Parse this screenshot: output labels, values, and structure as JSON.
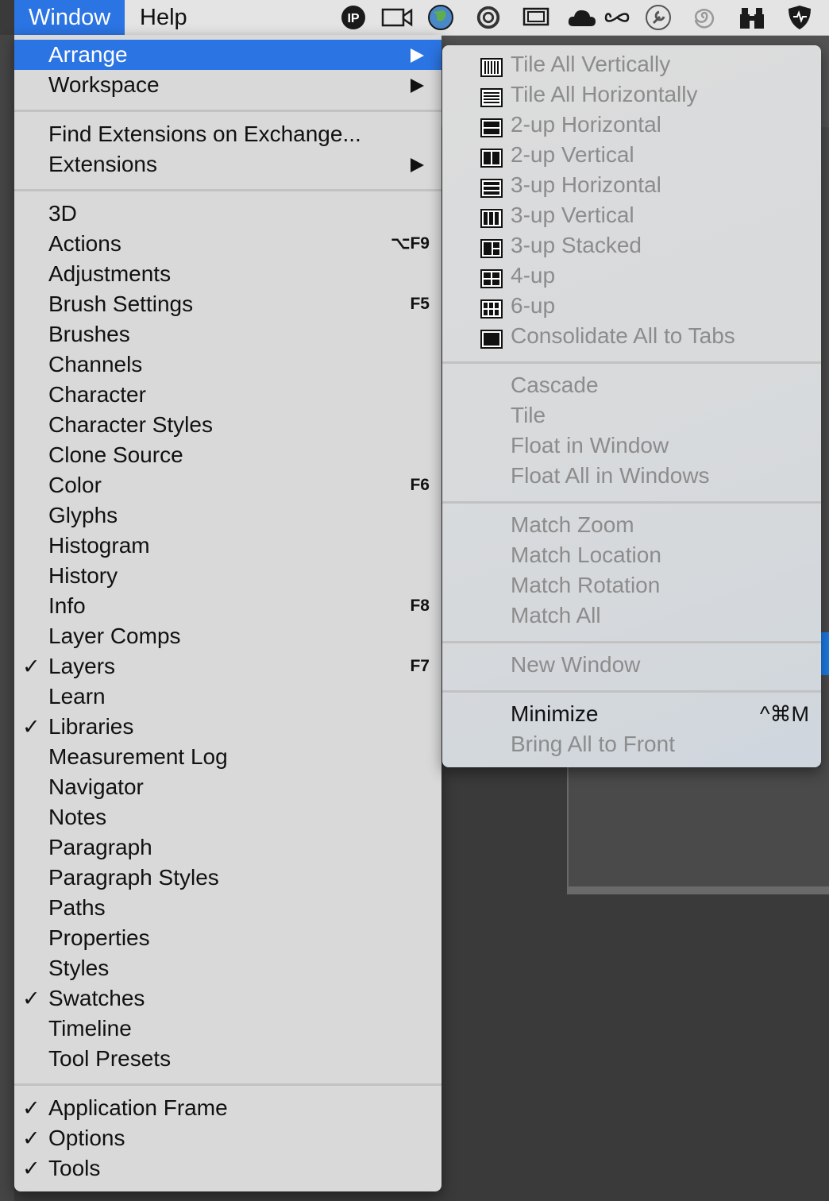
{
  "menubar": {
    "window_label": "Window",
    "help_label": "Help",
    "status_icons": [
      "ip-icon",
      "video-camera-icon",
      "globe-icon",
      "creative-cloud-icon",
      "display-icon",
      "cloud-icon",
      "infinity-icon",
      "wrench-icon",
      "spiral-icon",
      "binoculars-icon",
      "shield-icon"
    ]
  },
  "menu": {
    "arrange": "Arrange",
    "workspace": "Workspace",
    "find_extensions": "Find Extensions on Exchange...",
    "extensions": "Extensions",
    "panels": [
      {
        "label": "3D",
        "shortcut": "",
        "checked": false
      },
      {
        "label": "Actions",
        "shortcut": "⌥F9",
        "checked": false
      },
      {
        "label": "Adjustments",
        "shortcut": "",
        "checked": false
      },
      {
        "label": "Brush Settings",
        "shortcut": "F5",
        "checked": false
      },
      {
        "label": "Brushes",
        "shortcut": "",
        "checked": false
      },
      {
        "label": "Channels",
        "shortcut": "",
        "checked": false
      },
      {
        "label": "Character",
        "shortcut": "",
        "checked": false
      },
      {
        "label": "Character Styles",
        "shortcut": "",
        "checked": false
      },
      {
        "label": "Clone Source",
        "shortcut": "",
        "checked": false
      },
      {
        "label": "Color",
        "shortcut": "F6",
        "checked": false
      },
      {
        "label": "Glyphs",
        "shortcut": "",
        "checked": false
      },
      {
        "label": "Histogram",
        "shortcut": "",
        "checked": false
      },
      {
        "label": "History",
        "shortcut": "",
        "checked": false
      },
      {
        "label": "Info",
        "shortcut": "F8",
        "checked": false
      },
      {
        "label": "Layer Comps",
        "shortcut": "",
        "checked": false
      },
      {
        "label": "Layers",
        "shortcut": "F7",
        "checked": true
      },
      {
        "label": "Learn",
        "shortcut": "",
        "checked": false
      },
      {
        "label": "Libraries",
        "shortcut": "",
        "checked": true
      },
      {
        "label": "Measurement Log",
        "shortcut": "",
        "checked": false
      },
      {
        "label": "Navigator",
        "shortcut": "",
        "checked": false
      },
      {
        "label": "Notes",
        "shortcut": "",
        "checked": false
      },
      {
        "label": "Paragraph",
        "shortcut": "",
        "checked": false
      },
      {
        "label": "Paragraph Styles",
        "shortcut": "",
        "checked": false
      },
      {
        "label": "Paths",
        "shortcut": "",
        "checked": false
      },
      {
        "label": "Properties",
        "shortcut": "",
        "checked": false
      },
      {
        "label": "Styles",
        "shortcut": "",
        "checked": false
      },
      {
        "label": "Swatches",
        "shortcut": "",
        "checked": true
      },
      {
        "label": "Timeline",
        "shortcut": "",
        "checked": false
      },
      {
        "label": "Tool Presets",
        "shortcut": "",
        "checked": false
      }
    ],
    "frames": [
      {
        "label": "Application Frame",
        "checked": true
      },
      {
        "label": "Options",
        "checked": true
      },
      {
        "label": "Tools",
        "checked": true
      }
    ],
    "check_glyph": "✓"
  },
  "submenu": {
    "layouts": [
      {
        "label": "Tile All Vertically",
        "icon": "tile-vertical-icon"
      },
      {
        "label": "Tile All Horizontally",
        "icon": "tile-horizontal-icon"
      },
      {
        "label": "2-up Horizontal",
        "icon": "two-up-horizontal-icon"
      },
      {
        "label": "2-up Vertical",
        "icon": "two-up-vertical-icon"
      },
      {
        "label": "3-up Horizontal",
        "icon": "three-up-horizontal-icon"
      },
      {
        "label": "3-up Vertical",
        "icon": "three-up-vertical-icon"
      },
      {
        "label": "3-up Stacked",
        "icon": "three-up-stacked-icon"
      },
      {
        "label": "4-up",
        "icon": "four-up-icon"
      },
      {
        "label": "6-up",
        "icon": "six-up-icon"
      },
      {
        "label": "Consolidate All to Tabs",
        "icon": "consolidate-tabs-icon"
      }
    ],
    "window_ops": [
      "Cascade",
      "Tile",
      "Float in Window",
      "Float All in Windows"
    ],
    "match_ops": [
      "Match Zoom",
      "Match Location",
      "Match Rotation",
      "Match All"
    ],
    "new_window": "New Window",
    "minimize": "Minimize",
    "minimize_shortcut": "^⌘M",
    "bring_all": "Bring All to Front"
  }
}
